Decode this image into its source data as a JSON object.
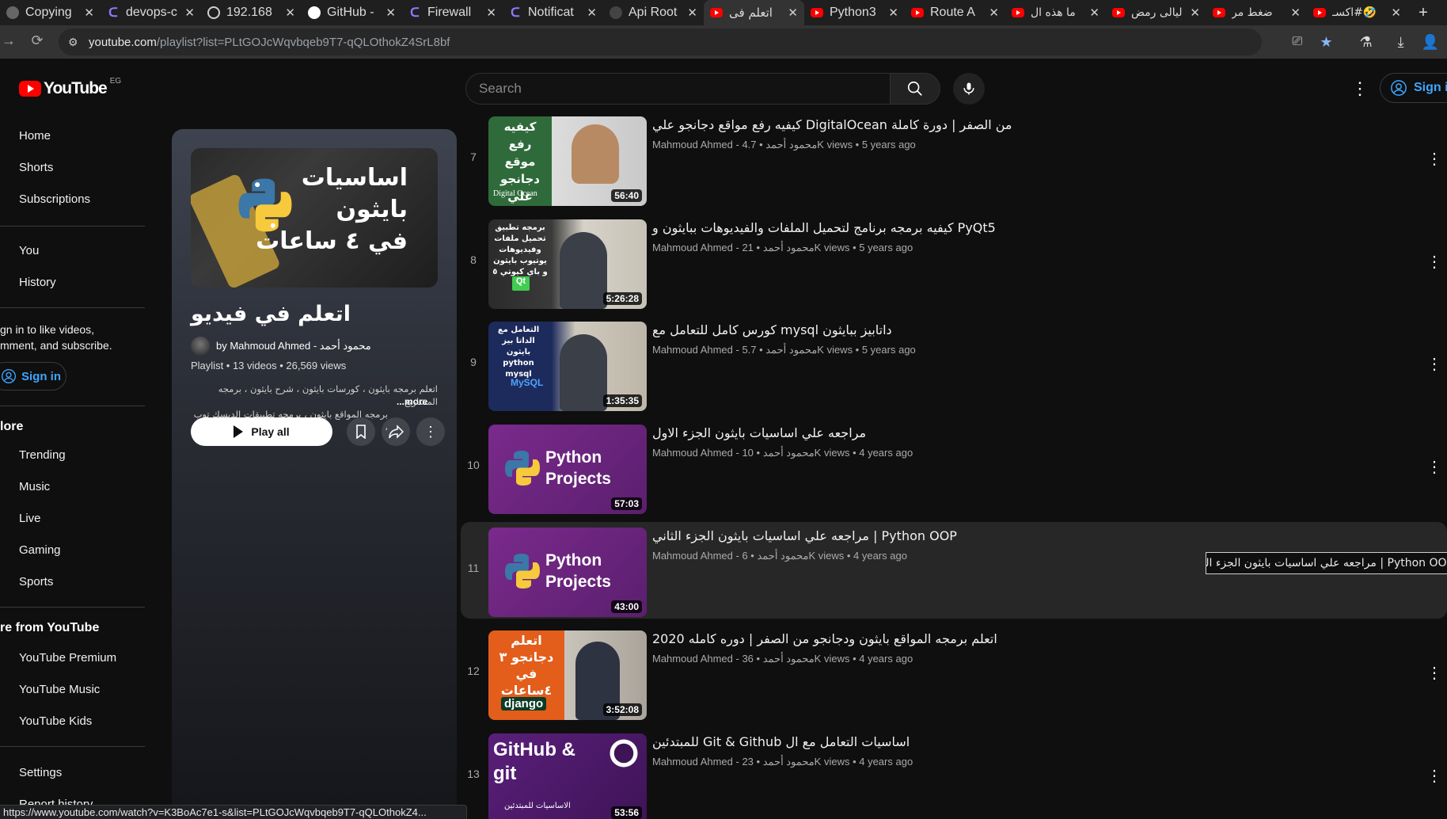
{
  "browser": {
    "tabs": [
      {
        "title": "Copying",
        "icon": "copy-icon"
      },
      {
        "title": "devops-c",
        "icon": "c-icon"
      },
      {
        "title": "192.168",
        "icon": "globe-icon"
      },
      {
        "title": "GitHub -",
        "icon": "github-icon"
      },
      {
        "title": "Firewall",
        "icon": "c-icon"
      },
      {
        "title": "Notificat",
        "icon": "c-icon"
      },
      {
        "title": "Api Root",
        "icon": "api-icon"
      },
      {
        "title": "اتعلم فى",
        "icon": "youtube-icon"
      },
      {
        "title": "Python3",
        "icon": "youtube-icon"
      },
      {
        "title": "Route A",
        "icon": "youtube-icon"
      },
      {
        "title": "ما هذه ال",
        "icon": "youtube-icon"
      },
      {
        "title": "ليالى رمض",
        "icon": "youtube-icon"
      },
      {
        "title": "ضغط مر",
        "icon": "youtube-icon"
      },
      {
        "title": "🤣#اكسـ",
        "icon": "youtube-icon"
      }
    ],
    "url_host": "youtube.com",
    "url_rest": "/playlist?list=PLtGOJcWqvbqeb9T7-qQLOthokZ4SrL8bf"
  },
  "header": {
    "logo": "YouTube",
    "country": "EG",
    "search_placeholder": "Search",
    "sign_in": "Sign in"
  },
  "sidebar": {
    "main": [
      "Home",
      "Shorts",
      "Subscriptions"
    ],
    "you": [
      "You",
      "History"
    ],
    "signin_prompt_1": "gn in to like videos,",
    "signin_prompt_2": "mment, and subscribe.",
    "signin": "Sign in",
    "explore_head": "lore",
    "explore": [
      "Trending",
      "Music",
      "Live",
      "Gaming",
      "Sports"
    ],
    "more_head": "re from YouTube",
    "more": [
      "YouTube Premium",
      "YouTube Music",
      "YouTube Kids"
    ],
    "settings": [
      "Settings",
      "Report history"
    ]
  },
  "playlist": {
    "thumb_line1": "اساسيات",
    "thumb_line2": "بايثون",
    "thumb_line3": "في ٤ ساعات",
    "title": "اتعلم في فيديو",
    "owner": "by Mahmoud Ahmed - محمود أحمد",
    "meta": "Playlist • 13 videos • 26,569 views",
    "desc_line1": "اتعلم برمجه بايثون ، كورسات بايثون ، شرح بايثون ، برمجه المشاريع",
    "desc_line2": "برمجه المواقع بايثون ، برمجه تطبيقات الديسك توب ،",
    "more": "...more",
    "play_all": "Play all"
  },
  "videos": [
    {
      "num": "7",
      "title": "من الصفر | دورة كاملة DigitalOcean كيفيه رفع مواقع دجانجو علي",
      "meta": "Mahmoud Ahmed - محمود أحمد • 4.7K views • 5 years ago",
      "duration": "56:40",
      "thumb_text": "كيفيه رفع موقع دجانجو علي",
      "thumb_sub": "Digital Ocean"
    },
    {
      "num": "8",
      "title": "PyQt5 كيفيه برمجه برنامج لتحميل الملفات والفيديوهات ببايثون و",
      "meta": "Mahmoud Ahmed - محمود أحمد • 21K views • 5 years ago",
      "duration": "5:26:28",
      "thumb_text": "برمجه تطبيق تحميل ملفات وفيديوهات يوتيوب بايثون و باي كيوتي ٥",
      "thumb_sub": "Qt"
    },
    {
      "num": "9",
      "title": "داتابيز ببايثون mysql كورس كامل للتعامل مع",
      "meta": "Mahmoud Ahmed - محمود أحمد • 5.7K views • 5 years ago",
      "duration": "1:35:35",
      "thumb_text": "التعامل مع الداتا بيز بايثون python mysql",
      "thumb_sub": "MySQL"
    },
    {
      "num": "10",
      "title": "مراجعه علي اساسيات بايثون الجزء الاول",
      "meta": "Mahmoud Ahmed - محمود أحمد • 10K views • 4 years ago",
      "duration": "57:03",
      "thumb_text": "Python Projects",
      "thumb_sub": ""
    },
    {
      "num": "11",
      "title": "Python OOP | مراجعه علي اساسيات بايثون الجزء الثاني",
      "meta": "Mahmoud Ahmed - محمود أحمد • 6K views • 4 years ago",
      "duration": "43:00",
      "thumb_text": "Python Projects",
      "thumb_sub": ""
    },
    {
      "num": "12",
      "title": "اتعلم برمجه المواقع بايثون ودجانجو من الصفر | دوره كامله 2020",
      "meta": "Mahmoud Ahmed - محمود أحمد • 36K views • 4 years ago",
      "duration": "3:52:08",
      "thumb_text": "اتعلم دجانجو ٣ في ٤ساعات",
      "thumb_sub": "django"
    },
    {
      "num": "13",
      "title": "اساسيات التعامل مع ال Git & Github للمبتدئين",
      "meta": "Mahmoud Ahmed - محمود أحمد • 23K views • 4 years ago",
      "duration": "53:56",
      "thumb_text": "GitHub & git",
      "thumb_sub": "الاساسيات للمبتدئين"
    }
  ],
  "tooltip": "Python OOP | مراجعه علي اساسيات بايثون الجزء الثاني",
  "status_url": "https://www.youtube.com/watch?v=K3BoAc7e1-s&list=PLtGOJcWqvbqeb9T7-qQLOthokZ4..."
}
